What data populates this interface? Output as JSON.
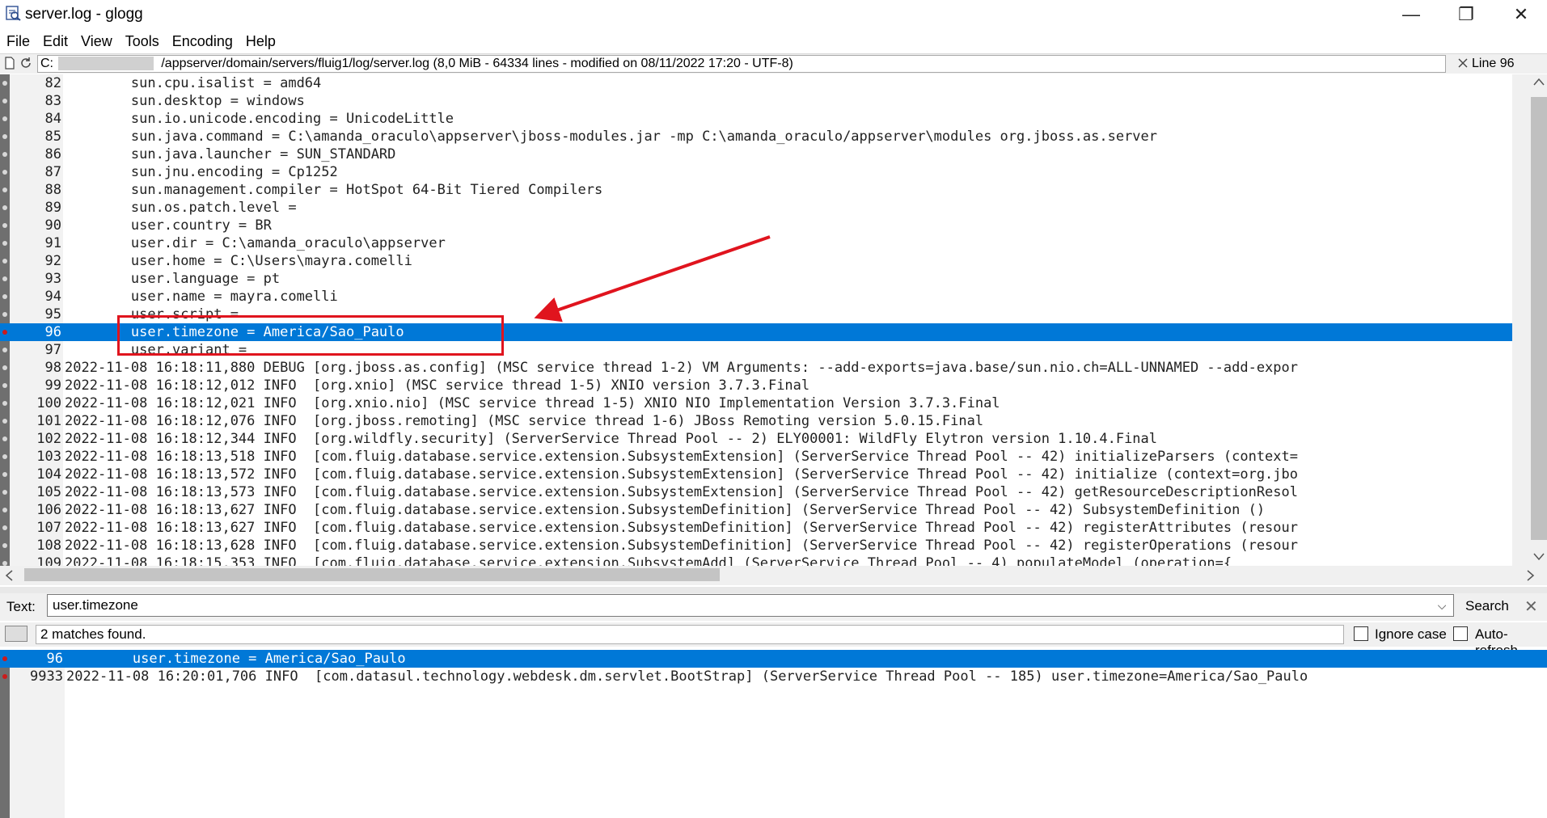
{
  "window": {
    "title": "server.log - glogg",
    "controls": [
      "—",
      "❐",
      "✕"
    ]
  },
  "menu": [
    "File",
    "Edit",
    "View",
    "Tools",
    "Encoding",
    "Help"
  ],
  "pathbar": {
    "path": "C:                              /appserver/domain/servers/fluig1/log/server.log (8,0 MiB - 64334 lines - modified on 08/11/2022 17:20 - UTF-8)",
    "line_indicator": "Line 96"
  },
  "log_lines": [
    {
      "n": "82",
      "t": "        sun.cpu.isalist = amd64",
      "mark": false
    },
    {
      "n": "83",
      "t": "        sun.desktop = windows",
      "mark": false
    },
    {
      "n": "84",
      "t": "        sun.io.unicode.encoding = UnicodeLittle",
      "mark": false
    },
    {
      "n": "85",
      "t": "        sun.java.command = C:\\amanda_oraculo\\appserver\\jboss-modules.jar -mp C:\\amanda_oraculo/appserver\\modules org.jboss.as.server",
      "mark": false
    },
    {
      "n": "86",
      "t": "        sun.java.launcher = SUN_STANDARD",
      "mark": false
    },
    {
      "n": "87",
      "t": "        sun.jnu.encoding = Cp1252",
      "mark": false
    },
    {
      "n": "88",
      "t": "        sun.management.compiler = HotSpot 64-Bit Tiered Compilers",
      "mark": false
    },
    {
      "n": "89",
      "t": "        sun.os.patch.level =",
      "mark": false
    },
    {
      "n": "90",
      "t": "        user.country = BR",
      "mark": false
    },
    {
      "n": "91",
      "t": "        user.dir = C:\\amanda_oraculo\\appserver",
      "mark": false
    },
    {
      "n": "92",
      "t": "        user.home = C:\\Users\\mayra.comelli",
      "mark": false
    },
    {
      "n": "93",
      "t": "        user.language = pt",
      "mark": false
    },
    {
      "n": "94",
      "t": "        user.name = mayra.comelli",
      "mark": false
    },
    {
      "n": "95",
      "t": "        user.script =",
      "mark": false
    },
    {
      "n": "96",
      "t": "        user.timezone = America/Sao_Paulo",
      "mark": true
    },
    {
      "n": "97",
      "t": "        user.variant =",
      "mark": false
    },
    {
      "n": "98",
      "t": "2022-11-08 16:18:11,880 DEBUG [org.jboss.as.config] (MSC service thread 1-2) VM Arguments: --add-exports=java.base/sun.nio.ch=ALL-UNNAMED --add-expor",
      "mark": false
    },
    {
      "n": "99",
      "t": "2022-11-08 16:18:12,012 INFO  [org.xnio] (MSC service thread 1-5) XNIO version 3.7.3.Final",
      "mark": false
    },
    {
      "n": "100",
      "t": "2022-11-08 16:18:12,021 INFO  [org.xnio.nio] (MSC service thread 1-5) XNIO NIO Implementation Version 3.7.3.Final",
      "mark": false
    },
    {
      "n": "101",
      "t": "2022-11-08 16:18:12,076 INFO  [org.jboss.remoting] (MSC service thread 1-6) JBoss Remoting version 5.0.15.Final",
      "mark": false
    },
    {
      "n": "102",
      "t": "2022-11-08 16:18:12,344 INFO  [org.wildfly.security] (ServerService Thread Pool -- 2) ELY00001: WildFly Elytron version 1.10.4.Final",
      "mark": false
    },
    {
      "n": "103",
      "t": "2022-11-08 16:18:13,518 INFO  [com.fluig.database.service.extension.SubsystemExtension] (ServerService Thread Pool -- 42) initializeParsers (context=",
      "mark": false
    },
    {
      "n": "104",
      "t": "2022-11-08 16:18:13,572 INFO  [com.fluig.database.service.extension.SubsystemExtension] (ServerService Thread Pool -- 42) initialize (context=org.jbo",
      "mark": false
    },
    {
      "n": "105",
      "t": "2022-11-08 16:18:13,573 INFO  [com.fluig.database.service.extension.SubsystemExtension] (ServerService Thread Pool -- 42) getResourceDescriptionResol",
      "mark": false
    },
    {
      "n": "106",
      "t": "2022-11-08 16:18:13,627 INFO  [com.fluig.database.service.extension.SubsystemDefinition] (ServerService Thread Pool -- 42) SubsystemDefinition ()",
      "mark": false
    },
    {
      "n": "107",
      "t": "2022-11-08 16:18:13,627 INFO  [com.fluig.database.service.extension.SubsystemDefinition] (ServerService Thread Pool -- 42) registerAttributes (resour",
      "mark": false
    },
    {
      "n": "108",
      "t": "2022-11-08 16:18:13,628 INFO  [com.fluig.database.service.extension.SubsystemDefinition] (ServerService Thread Pool -- 42) registerOperations (resour",
      "mark": false
    },
    {
      "n": "109",
      "t": "2022-11-08 16:18:15,353 INFO  [com.fluig.database.service.extension.SubsystemAdd] (ServerService Thread Pool -- 4) populateModel (operation={",
      "mark": false
    }
  ],
  "selected_line": "96",
  "search": {
    "label": "Text:",
    "value": "user.timezone",
    "button": "Search",
    "close": "✕"
  },
  "status": {
    "text": "2 matches found.",
    "ignore_case": "Ignore case",
    "auto_refresh": "Auto-refresh"
  },
  "results": [
    {
      "n": "96",
      "t": "        user.timezone = America/Sao_Paulo"
    },
    {
      "n": "9933",
      "t": "2022-11-08 16:20:01,706 INFO  [com.datasul.technology.webdesk.dm.servlet.BootStrap] (ServerService Thread Pool -- 185) user.timezone=America/Sao_Paulo"
    }
  ],
  "colors": {
    "selection": "#0078d7",
    "annotation": "#e0141e",
    "marker": "#cc1b1b"
  }
}
